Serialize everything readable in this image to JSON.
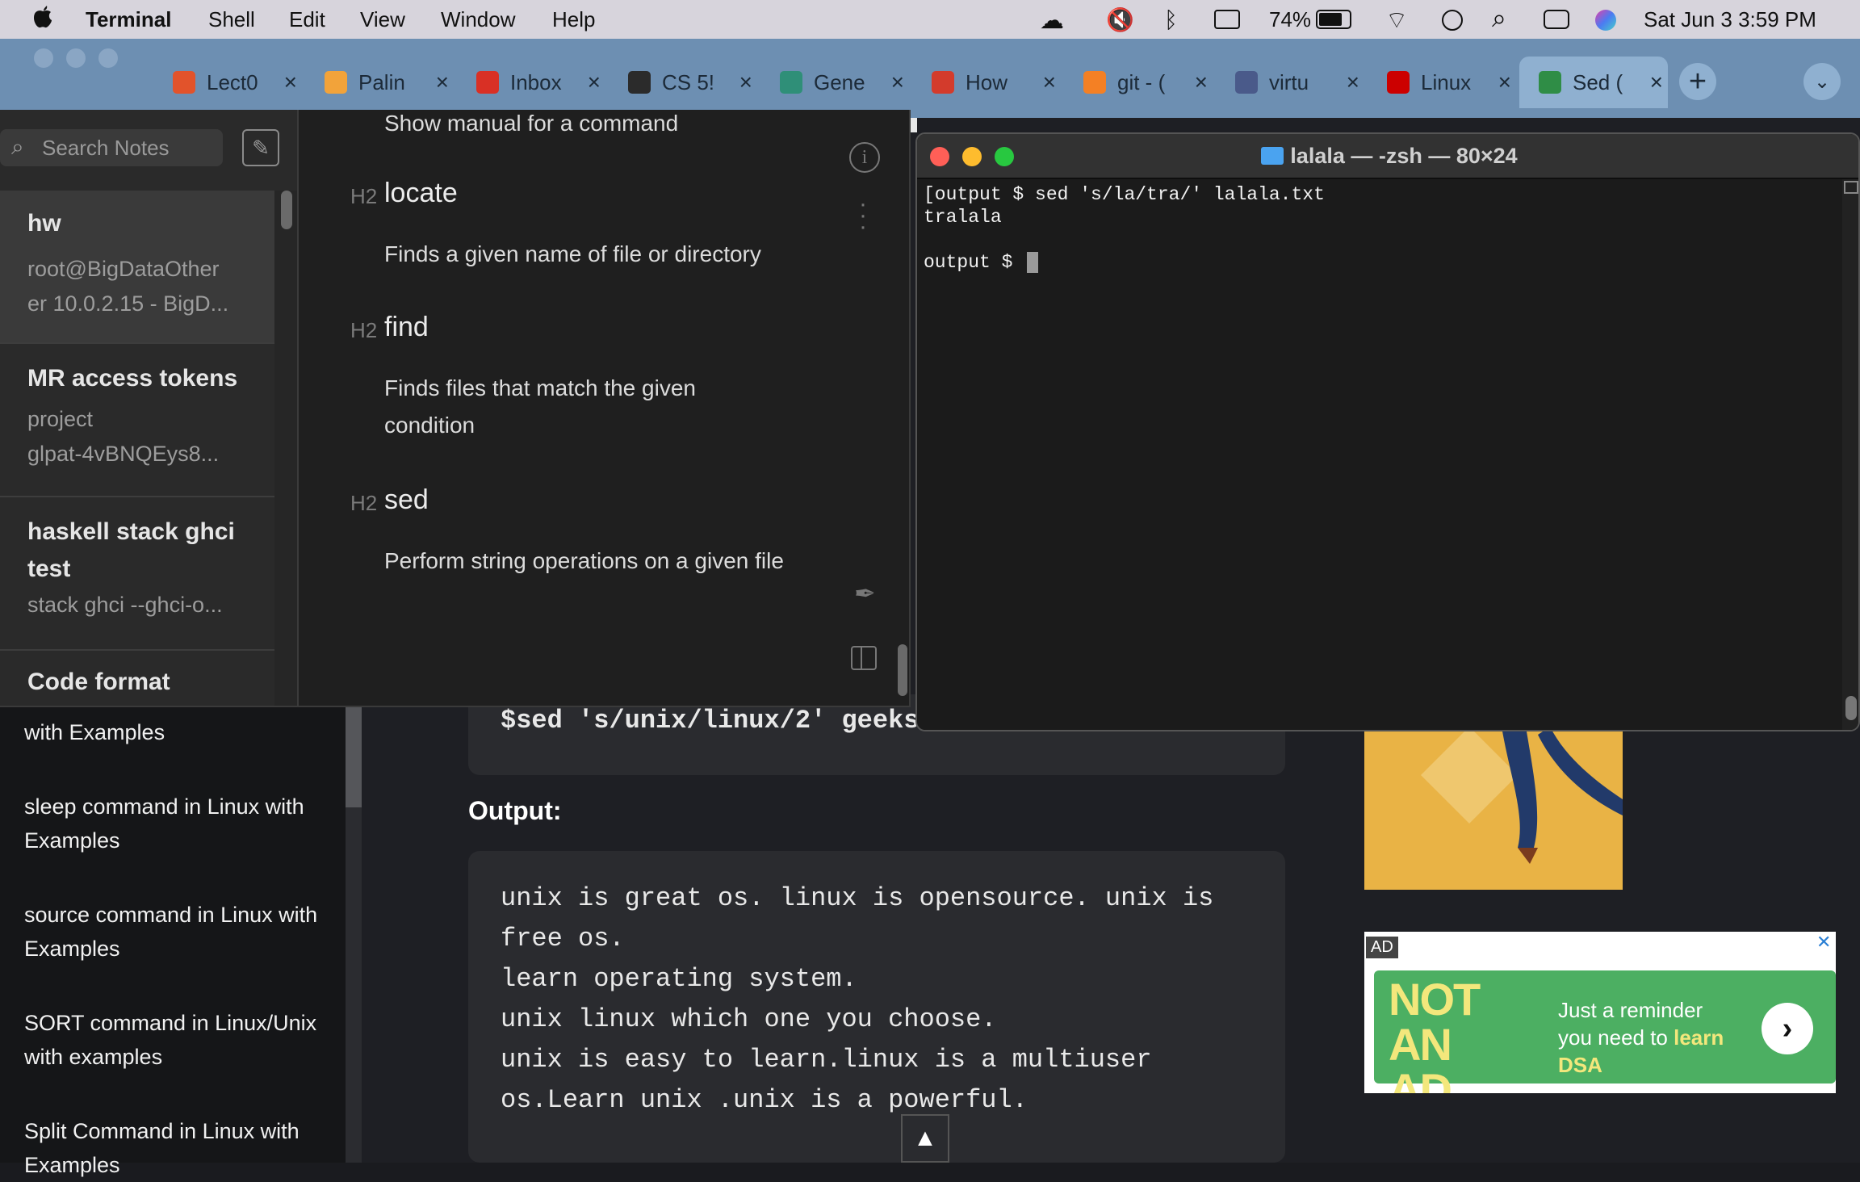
{
  "menubar": {
    "apple": "",
    "app_name": "Terminal",
    "items": [
      "Shell",
      "Edit",
      "View",
      "Window",
      "Help"
    ],
    "battery": "74%",
    "clock": "Sat Jun 3  3:59 PM"
  },
  "browser": {
    "tabs": [
      {
        "label": "Lect0",
        "icon": "lecture-icon",
        "color": "#e2532b"
      },
      {
        "label": "Palin",
        "icon": "leetcode-icon",
        "color": "#f2a33a"
      },
      {
        "label": "Inbox",
        "icon": "gmail-icon",
        "color": "#d93025"
      },
      {
        "label": "CS 5!",
        "icon": "document-icon",
        "color": "#2b2b2b"
      },
      {
        "label": "Gene",
        "icon": "chatgpt-icon",
        "color": "#2f8f78"
      },
      {
        "label": "How",
        "icon": "tuple-icon",
        "color": "#d33b2c"
      },
      {
        "label": "git - (",
        "icon": "stackoverflow-icon",
        "color": "#f48024"
      },
      {
        "label": "virtu",
        "icon": "university-icon",
        "color": "#4a5a8a"
      },
      {
        "label": "Linux",
        "icon": "redhat-icon",
        "color": "#cc0000"
      },
      {
        "label": "Sed (",
        "icon": "geeksforgeeks-icon",
        "color": "#2f8d46"
      }
    ]
  },
  "webpage": {
    "code_top": "$sed 's/unix/linux/2' geeks",
    "output_label": "Output:",
    "output_lines": [
      "unix is great os. linux is opensource. unix is",
      "free os.",
      "learn operating system.",
      "unix linux which one you choose.",
      "unix is easy to learn.linux is a multiuser",
      "os.Learn unix .unix is a powerful."
    ],
    "sidebar_links": [
      "with Examples",
      "sleep command in Linux with Examples",
      "source command in Linux with Examples",
      "SORT command in Linux/Unix with examples",
      "Split Command in Linux with Examples"
    ],
    "ad": {
      "badge": "AD",
      "headline": "NOT AN AD",
      "text": "Just a reminder you need to ",
      "highlight": "learn DSA"
    }
  },
  "notes": {
    "search_placeholder": "Search Notes",
    "list": [
      {
        "title": "hw",
        "sub1": "root@BigDataOther",
        "sub2": "er 10.0.2.15 - BigD..."
      },
      {
        "title": "MR access tokens",
        "sub1": "project",
        "sub2": "glpat-4vBNQEys8..."
      },
      {
        "title": "haskell stack ghci",
        "title2": "test",
        "sub1": "stack ghci --ghci-o..."
      },
      {
        "title": "Code format"
      }
    ],
    "editor": {
      "top_text": "Show manual for a command",
      "heading_tag": "H2",
      "sections": [
        {
          "heading": "locate",
          "lines": [
            "Finds a given name of file or directory"
          ]
        },
        {
          "heading": "find",
          "lines": [
            "Finds files that match the given",
            "condition"
          ]
        },
        {
          "heading": "sed",
          "lines": [
            "Perform string operations on a given file"
          ]
        }
      ]
    }
  },
  "terminal": {
    "title": "lalala — -zsh — 80×24",
    "lines": [
      "[output $ sed 's/la/tra/' lalala.txt",
      "tralala",
      "",
      "output $ "
    ]
  }
}
